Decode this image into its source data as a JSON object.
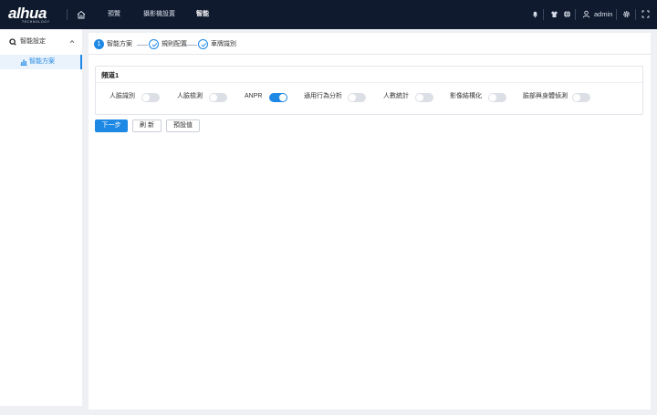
{
  "header": {
    "logo": "alhua",
    "logo_sub": "TECHNOLOGY",
    "nav": [
      "預覽",
      "攝影機設置",
      "智能"
    ],
    "active_nav": 2,
    "user": "admin"
  },
  "sidebar": {
    "group_label": "智能設定",
    "items": [
      {
        "label": "智能方案"
      }
    ]
  },
  "steps": [
    {
      "label": "智能方案",
      "number": "1"
    },
    {
      "label": "規則配置"
    },
    {
      "label": "車牌識別"
    }
  ],
  "channel": {
    "title": "頻道1",
    "features": [
      {
        "label": "人臉識別",
        "on": false
      },
      {
        "label": "人臉檢測",
        "on": false
      },
      {
        "label": "ANPR",
        "on": true
      },
      {
        "label": "通用行為分析",
        "on": false
      },
      {
        "label": "人數統計",
        "on": false
      },
      {
        "label": "影像結構化",
        "on": false
      },
      {
        "label": "臉部與身體偵測",
        "on": false
      }
    ]
  },
  "buttons": {
    "next": "下一步",
    "refresh": "刷 新",
    "default": "預設值"
  },
  "colors": {
    "accent": "#1e88e5",
    "topbar": "#0f1a2e"
  }
}
